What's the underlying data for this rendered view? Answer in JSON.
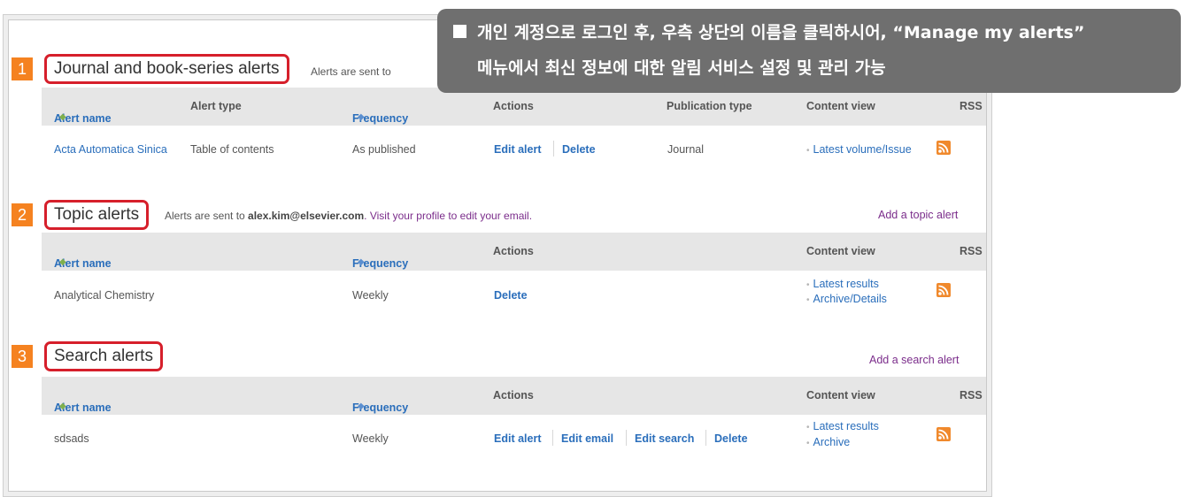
{
  "callout": {
    "line1": "개인 계정으로 로그인 후, 우측 상단의 이름을 클릭하시어, “Manage my alerts”",
    "line2": "메뉴에서 최신 정보에 대한 알림 서비스 설정 및 관리 가능"
  },
  "journal_section": {
    "badge": "1",
    "title": "Journal and book-series alerts",
    "note": "Alerts are sent to",
    "headers": {
      "alert_name": "Alert name",
      "alert_type": "Alert type",
      "frequency": "Frequency",
      "actions": "Actions",
      "publication_type": "Publication type",
      "content_view": "Content view",
      "rss": "RSS"
    },
    "row": {
      "alert_name": "Acta Automatica Sinica",
      "alert_type": "Table of contents",
      "frequency": "As published",
      "actions": [
        "Edit alert",
        "Delete"
      ],
      "publication_type": "Journal",
      "content_view": [
        "Latest volume/Issue"
      ]
    }
  },
  "topic_section": {
    "badge": "2",
    "title": "Topic alerts",
    "note_prefix": "Alerts are sent to ",
    "note_email": "alex.kim@elsevier.com",
    "note_suffix": ". Visit your profile to edit your email.",
    "add_link": "Add a topic alert",
    "headers": {
      "alert_name": "Alert name",
      "frequency": "Frequency",
      "actions": "Actions",
      "content_view": "Content view",
      "rss": "RSS"
    },
    "row": {
      "alert_name": "Analytical Chemistry",
      "frequency": "Weekly",
      "actions": [
        "Delete"
      ],
      "content_view": [
        "Latest results",
        "Archive/Details"
      ]
    }
  },
  "search_section": {
    "badge": "3",
    "title": "Search alerts",
    "add_link": "Add a search alert",
    "headers": {
      "alert_name": "Alert name",
      "frequency": "Frequency",
      "actions": "Actions",
      "content_view": "Content view",
      "rss": "RSS"
    },
    "row": {
      "alert_name": "sdsads",
      "frequency": "Weekly",
      "actions": [
        "Edit alert",
        "Edit email",
        "Edit search",
        "Delete"
      ],
      "content_view": [
        "Latest results",
        "Archive"
      ]
    }
  },
  "colors": {
    "highlight_border": "#d61f2b",
    "badge": "#f58220",
    "link": "#2a6ebb",
    "header_bg": "#e6e6e6",
    "callout_bg": "#6f6f6f",
    "rss": "#f0892c",
    "purple_link": "#7b2d8b"
  }
}
